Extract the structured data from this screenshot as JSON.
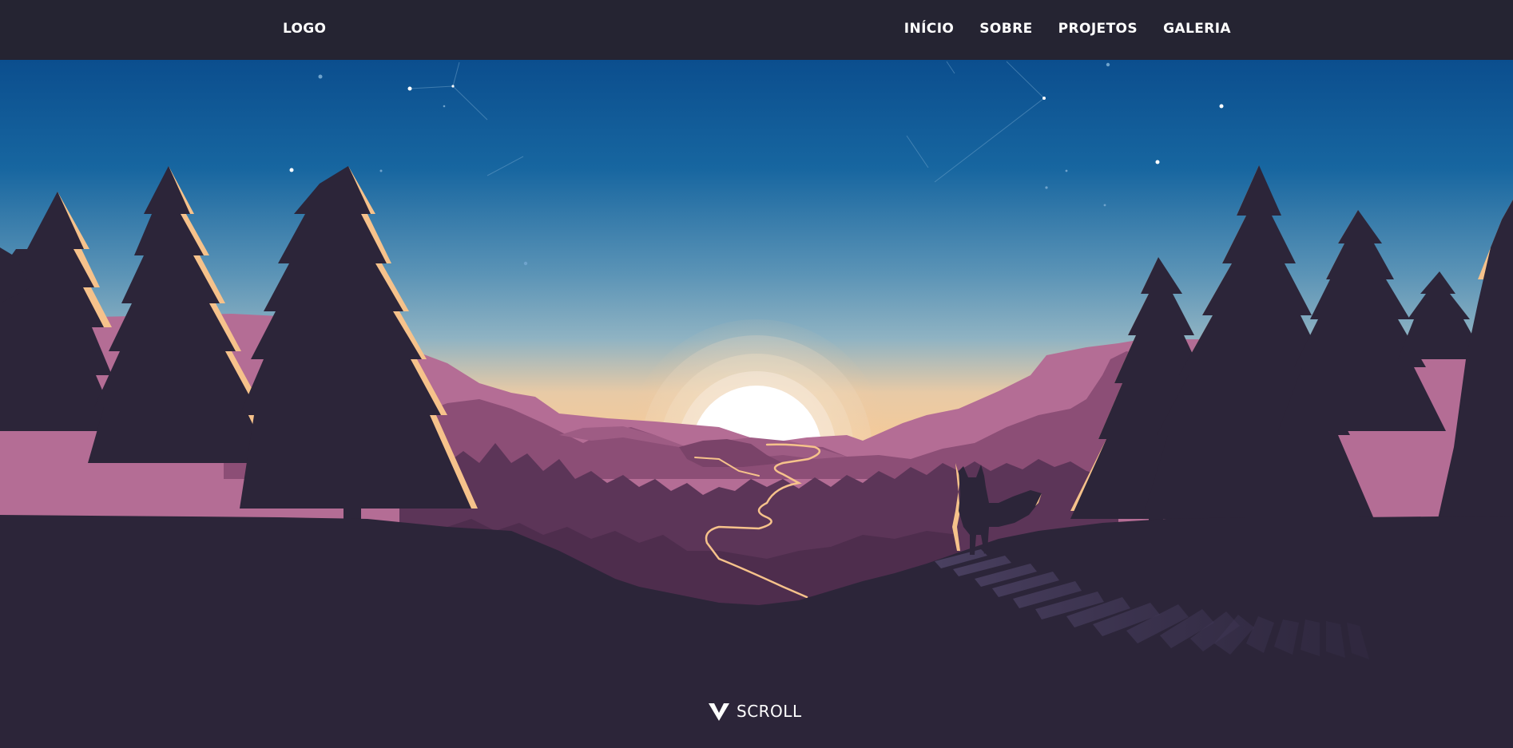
{
  "header": {
    "logo": "LOGO",
    "nav": [
      {
        "label": "INÍCIO"
      },
      {
        "label": "SOBRE"
      },
      {
        "label": "PROJETOS"
      },
      {
        "label": "GALERIA"
      }
    ]
  },
  "hero": {
    "scroll_label": "SCROLL",
    "scroll_icon": "chevron-down-icon"
  },
  "colors": {
    "navbar_bg": "#252432",
    "sky_top": "#0b4e8e",
    "sky_horizon": "#f7d4a3",
    "mountain_far": "#b46d95",
    "mountain_mid": "#8c4e76",
    "forest": "#5c3558",
    "tree": "#2c2539",
    "rim_light": "#f6c28b",
    "text": "#ffffff"
  }
}
